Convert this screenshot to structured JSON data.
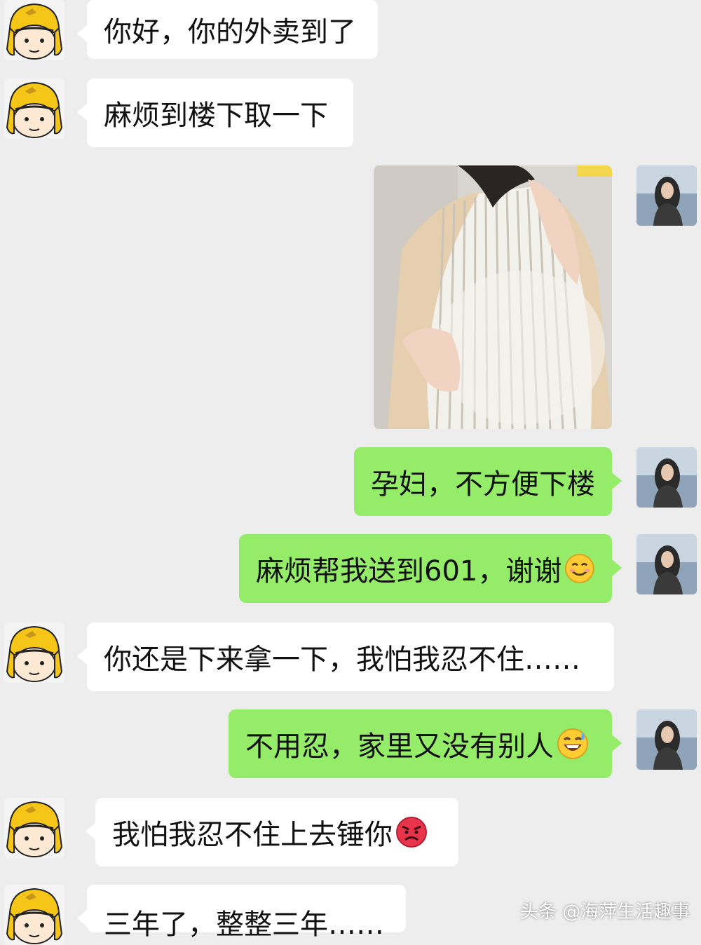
{
  "chat": {
    "messages": [
      {
        "side": "in",
        "text": "你好，你的外卖到了"
      },
      {
        "side": "in",
        "text": "麻烦到楼下取一下"
      },
      {
        "side": "out",
        "type": "image"
      },
      {
        "side": "out",
        "text": "孕妇，不方便下楼"
      },
      {
        "side": "out",
        "text": "麻烦帮我送到601，谢谢",
        "emoji": "smile-emoji"
      },
      {
        "side": "in",
        "text": "你还是下来拿一下，我怕我忍不住……"
      },
      {
        "side": "out",
        "text": "不用忍，家里又没有别人",
        "emoji": "sweat-smile-emoji"
      },
      {
        "side": "in",
        "text": "我怕我忍不住上去锤你",
        "emoji": "angry-emoji"
      },
      {
        "side": "in",
        "text": "三年了，整整三年……"
      }
    ]
  },
  "watermark": {
    "text": "头条 @海萍生活趣事"
  },
  "colors": {
    "background": "#ededed",
    "incoming": "#ffffff",
    "outgoing": "#95ec69",
    "courier_helmet": "#f5c518"
  }
}
